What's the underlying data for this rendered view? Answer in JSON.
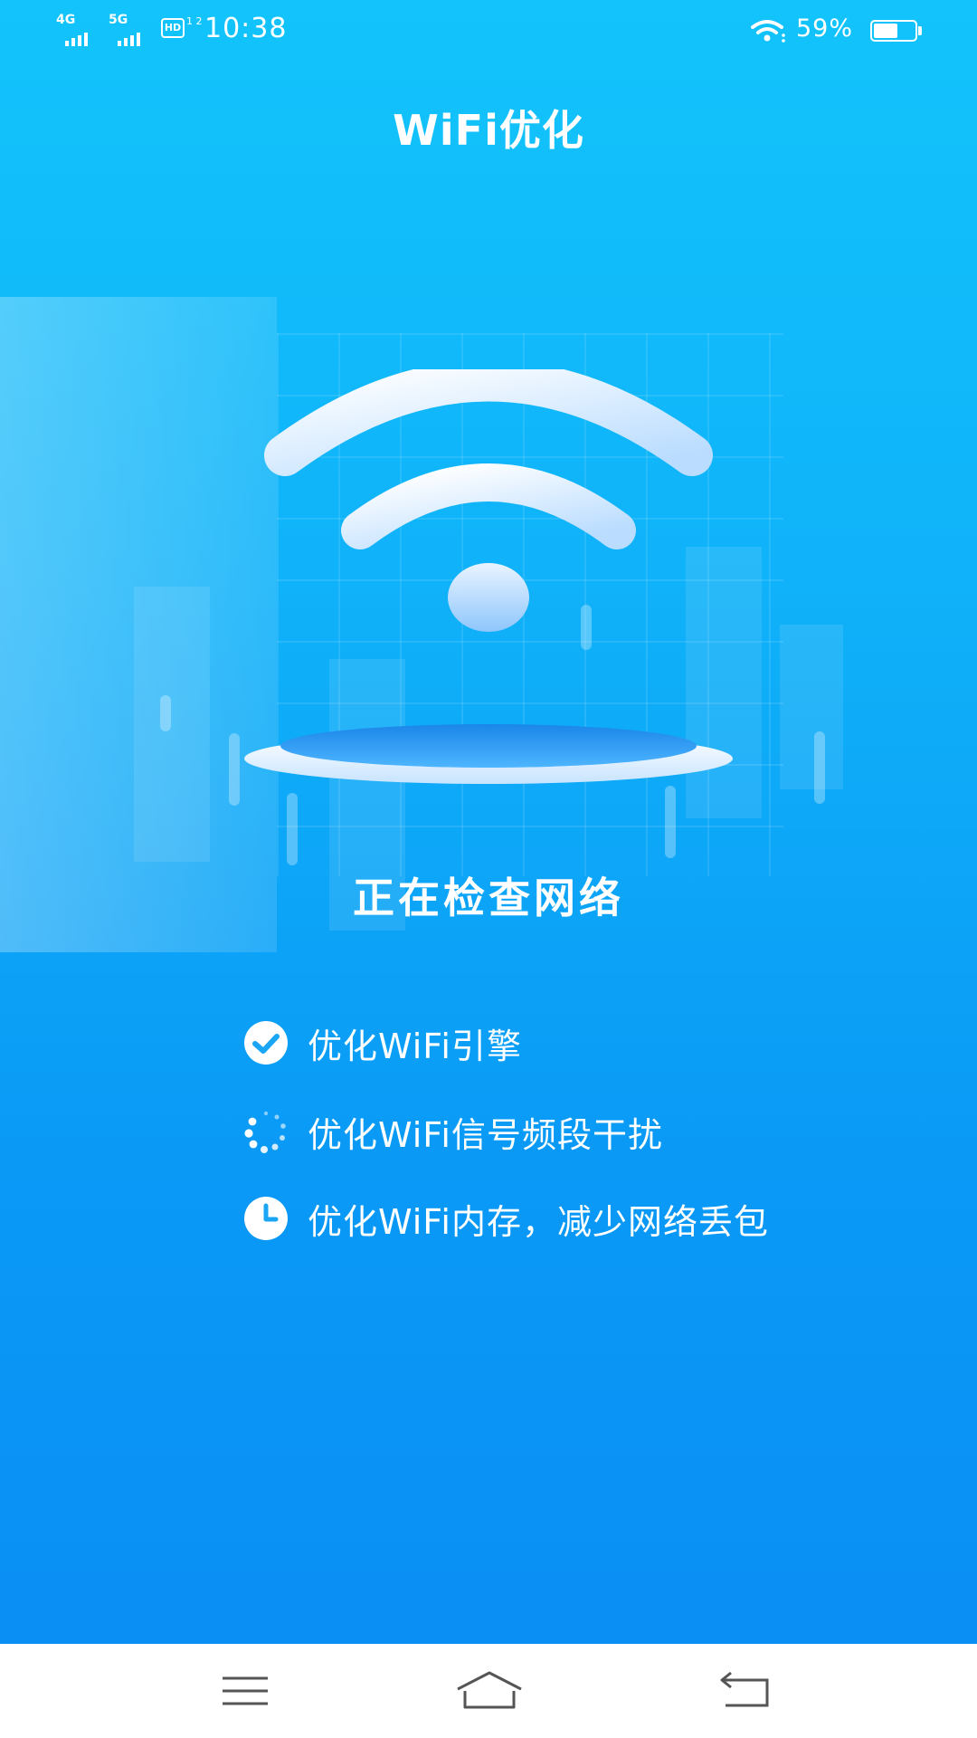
{
  "status_bar": {
    "sim1_network": "4G",
    "sim2_network": "5G",
    "hd_badge": "HD",
    "hd_sub": "1 2",
    "time": "10:38",
    "battery_percent_text": "59%",
    "battery_level": 0.59
  },
  "header": {
    "title": "WiFi优化"
  },
  "hero": {
    "status_text": "正在检查网络"
  },
  "steps": [
    {
      "icon": "check-circle-icon",
      "label": "优化WiFi引擎",
      "state": "done"
    },
    {
      "icon": "loading-spinner-icon",
      "label": "优化WiFi信号频段干扰",
      "state": "in-progress"
    },
    {
      "icon": "clock-icon",
      "label": "优化WiFi内存，减少网络丢包",
      "state": "pending"
    }
  ],
  "nav_bar": {
    "menu_icon": "menu-icon",
    "home_icon": "home-icon",
    "back_icon": "back-icon"
  },
  "colors": {
    "background_top": "#12c4fb",
    "background_bottom": "#0a8ff4",
    "icon_accent": "#1aa6f5",
    "nav_bar": "#ffffff",
    "nav_icon": "#555555"
  }
}
